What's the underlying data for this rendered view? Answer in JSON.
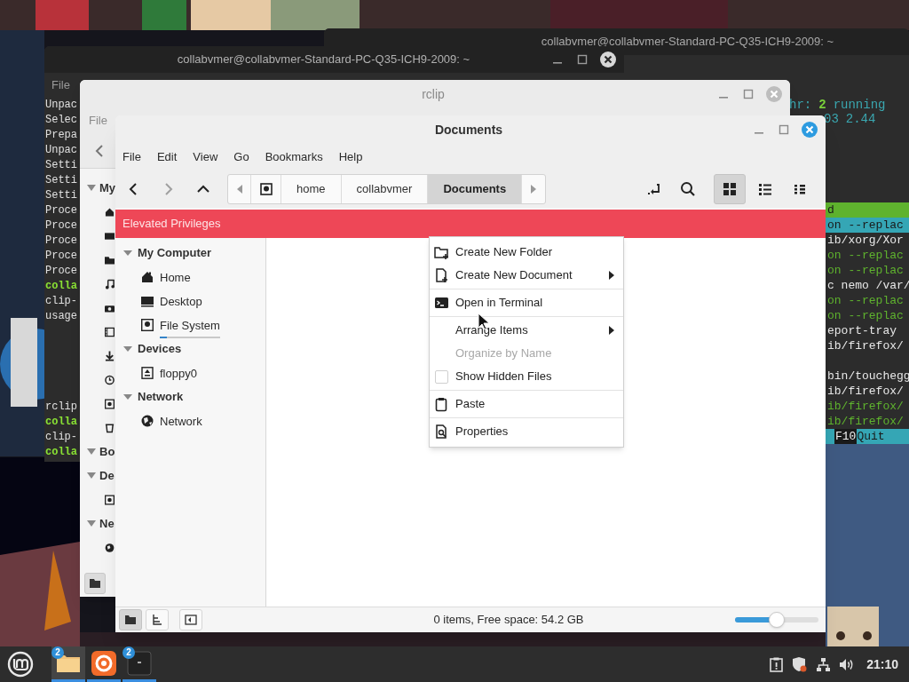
{
  "htop_window": {
    "title": "collabvmer@collabvmer-Standard-PC-Q35-ICH9-2009: ~",
    "header": [
      [
        {
          "text": "hr:",
          "kind": "label"
        },
        {
          "text": "2",
          "kind": "value"
        },
        {
          "text": "running",
          "kind": "label"
        }
      ],
      [
        {
          "text": "03",
          "kind": "label"
        },
        {
          "text": "2.44",
          "kind": "label"
        }
      ]
    ],
    "lines": [
      {
        "text": "d",
        "kind": "column-header"
      },
      {
        "text": "on --replac",
        "kind": "selected"
      },
      {
        "text": "ib/xorg/Xor",
        "kind": "process"
      },
      {
        "text": "on --replac",
        "kind": "thread"
      },
      {
        "text": "on --replac",
        "kind": "thread"
      },
      {
        "text": "c nemo /var/",
        "kind": "process"
      },
      {
        "text": "on --replac",
        "kind": "thread"
      },
      {
        "text": "on --replac",
        "kind": "thread"
      },
      {
        "text": "eport-tray",
        "kind": "process"
      },
      {
        "text": "ib/firefox/",
        "kind": "process"
      },
      {
        "kind": "blank"
      },
      {
        "text": "bin/touchegg",
        "kind": "process"
      },
      {
        "text": "ib/firefox/",
        "kind": "process"
      },
      {
        "text": "ib/firefox/",
        "kind": "thread"
      },
      {
        "text": "ib/firefox/",
        "kind": "thread"
      }
    ],
    "footer": {
      "key": "F10",
      "label": "Quit"
    }
  },
  "terminal_window": {
    "title": "collabvmer@collabvmer-Standard-PC-Q35-ICH9-2009: ~",
    "menu": [
      "File"
    ],
    "lines": [
      {
        "text": "Unpac",
        "kind": "output"
      },
      {
        "text": "Selec",
        "kind": "output"
      },
      {
        "text": "Prepa",
        "kind": "output"
      },
      {
        "text": "Unpac",
        "kind": "output"
      },
      {
        "text": "Setti",
        "kind": "output"
      },
      {
        "text": "Setti",
        "kind": "output"
      },
      {
        "text": "Setti",
        "kind": "output"
      },
      {
        "text": "Proce",
        "kind": "output"
      },
      {
        "text": "Proce",
        "kind": "output"
      },
      {
        "text": "Proce",
        "kind": "output"
      },
      {
        "text": "Proce",
        "kind": "output"
      },
      {
        "text": "Proce",
        "kind": "output"
      },
      {
        "text": "colla",
        "kind": "prompt"
      },
      {
        "text": "clip-",
        "kind": "output"
      },
      {
        "text": "usage",
        "kind": "output"
      },
      {
        "kind": "blank"
      },
      {
        "kind": "blank"
      },
      {
        "kind": "blank"
      },
      {
        "kind": "blank"
      },
      {
        "kind": "blank"
      },
      {
        "text": "rclip",
        "kind": "output"
      },
      {
        "text": "colla",
        "kind": "prompt"
      },
      {
        "text": "clip-",
        "kind": "output"
      },
      {
        "text": "colla",
        "kind": "prompt"
      }
    ]
  },
  "rclip_window": {
    "title": "rclip",
    "menu": [
      "File"
    ],
    "sidebar": [
      {
        "label": "My",
        "kind": "heading"
      },
      {
        "kind": "home"
      },
      {
        "kind": "desktop"
      },
      {
        "kind": "folder"
      },
      {
        "kind": "music"
      },
      {
        "kind": "camera"
      },
      {
        "kind": "film"
      },
      {
        "kind": "download"
      },
      {
        "kind": "clock"
      },
      {
        "kind": "drive"
      },
      {
        "kind": "trash"
      },
      {
        "label": "Bo",
        "kind": "heading"
      },
      {
        "label": "De",
        "kind": "section"
      },
      {
        "kind": "drive"
      },
      {
        "label": "Ne",
        "kind": "section"
      },
      {
        "kind": "globe"
      }
    ]
  },
  "files_window": {
    "title": "Documents",
    "menu": [
      "File",
      "Edit",
      "View",
      "Go",
      "Bookmarks",
      "Help"
    ],
    "nav": [
      {
        "kind": "back",
        "disabled": false
      },
      {
        "kind": "forward",
        "disabled": true
      },
      {
        "kind": "up",
        "disabled": false
      }
    ],
    "path": [
      {
        "label": "home",
        "selected": false
      },
      {
        "label": "collabvmer",
        "selected": false
      },
      {
        "label": "Documents",
        "selected": true
      }
    ],
    "views": [
      {
        "kind": "icons",
        "selected": true
      },
      {
        "kind": "list",
        "selected": false
      },
      {
        "kind": "compact",
        "selected": false
      }
    ],
    "banner": "Elevated Privileges",
    "sidebar": [
      {
        "label": "My Computer",
        "expanded": true,
        "children": [
          {
            "label": "Home",
            "kind": "home"
          },
          {
            "label": "Desktop",
            "kind": "desktop"
          },
          {
            "label": "File System",
            "kind": "drive",
            "level": 0.12
          }
        ]
      },
      {
        "label": "Devices",
        "expanded": true,
        "children": [
          {
            "label": "floppy0",
            "kind": "floppy"
          }
        ]
      },
      {
        "label": "Network",
        "expanded": true,
        "children": [
          {
            "label": "Network",
            "kind": "globe"
          }
        ]
      }
    ],
    "pane_buttons": [
      {
        "kind": "places",
        "selected": true
      },
      {
        "kind": "tree",
        "selected": false
      }
    ],
    "status": "0 items, Free space: 54.2 GB",
    "zoom": {
      "level": 0.5
    }
  },
  "context_menu": [
    [
      {
        "label": "Create New Folder",
        "kind": "new-folder",
        "submenu": false,
        "disabled": false
      },
      {
        "label": "Create New Document",
        "kind": "new-document",
        "submenu": true,
        "disabled": false
      }
    ],
    [
      {
        "label": "Open in Terminal",
        "kind": "terminal",
        "submenu": false,
        "disabled": false
      }
    ],
    [
      {
        "label": "Arrange Items",
        "kind": "plain",
        "submenu": true,
        "disabled": false
      },
      {
        "label": "Organize by Name",
        "kind": "plain",
        "submenu": false,
        "disabled": true
      },
      {
        "label": "Show Hidden Files",
        "kind": "checkbox",
        "checked": false,
        "submenu": false,
        "disabled": false
      }
    ],
    [
      {
        "label": "Paste",
        "kind": "paste",
        "submenu": false,
        "disabled": false
      }
    ],
    [
      {
        "label": "Properties",
        "kind": "properties",
        "submenu": false,
        "disabled": false
      }
    ]
  ],
  "taskbar": {
    "apps": [
      {
        "kind": "files",
        "badge": "2",
        "active": true
      },
      {
        "kind": "browser",
        "active": false
      },
      {
        "kind": "terminal",
        "badge": "2",
        "active": false
      }
    ],
    "clock": "21:10"
  }
}
